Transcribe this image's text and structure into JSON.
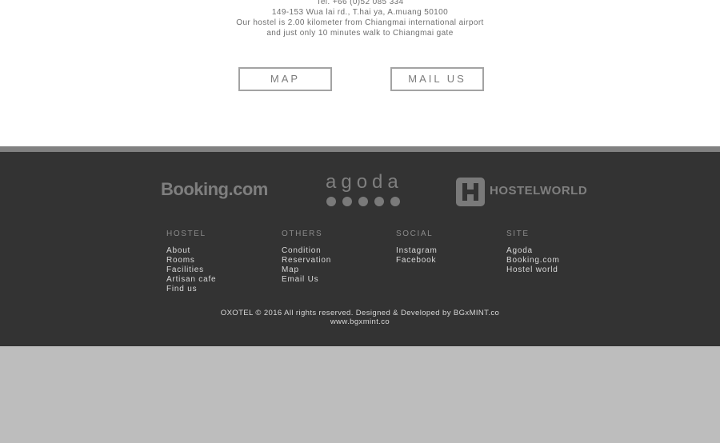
{
  "contact": {
    "tel": "Tel. +66 (0)52 085 334",
    "address": "149-153 Wua lai rd., T.hai ya, A.muang 50100",
    "distance_line1": "Our hostel is 2.00 kilometer from Chiangmai international airport",
    "distance_line2": "and just only 10 minutes walk to Chiangmai gate"
  },
  "buttons": {
    "map": "MAP",
    "mail": "MAIL US"
  },
  "partners": {
    "booking": "Booking.com",
    "agoda": "agoda",
    "hostelworld": "HOSTELWORLD"
  },
  "footer": {
    "columns": [
      {
        "title": "HOSTEL",
        "links": [
          "About",
          "Rooms",
          "Facilities",
          "Artisan cafe",
          "Find us"
        ]
      },
      {
        "title": "OTHERS",
        "links": [
          "Condition",
          "Reservation",
          "Map",
          "Email Us"
        ]
      },
      {
        "title": "SOCIAL",
        "links": [
          "Instagram",
          "Facebook"
        ]
      },
      {
        "title": "SITE",
        "links": [
          "Agoda",
          "Booking.com",
          "Hostel world"
        ]
      }
    ],
    "copyright": "OXOTEL © 2016 All rights reserved. Designed & Developed by BGxMINT.co",
    "website": "www.bgxmint.co"
  },
  "colors": {
    "footer_bg": "#333333",
    "stripe": "#818181",
    "page_bg": "#bdbdbd"
  }
}
